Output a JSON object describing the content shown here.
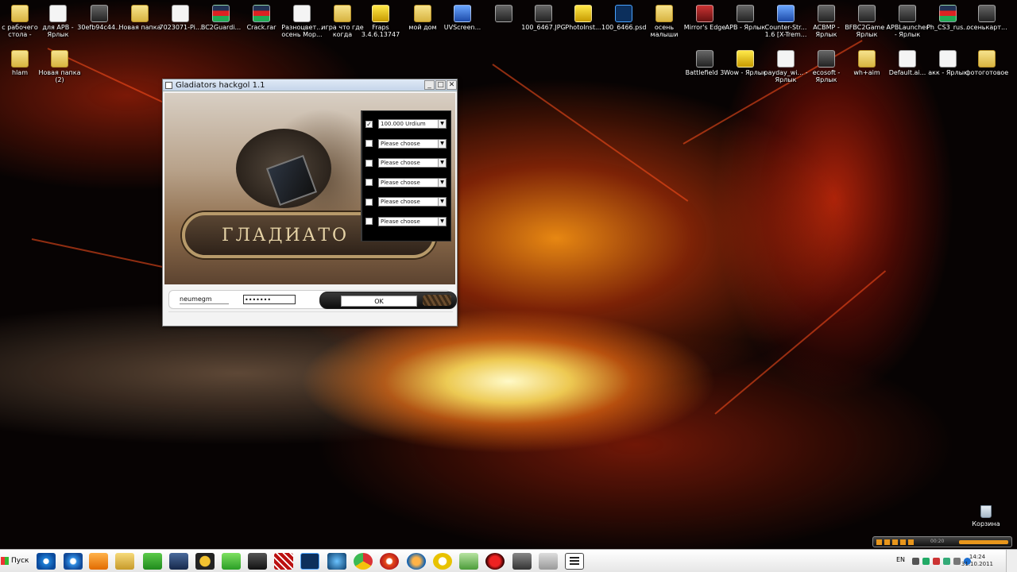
{
  "desktop": {
    "icons_row1": [
      {
        "label": "с рабочего стола - Ярлык",
        "icon": "folder-shortcut-icon",
        "kind": "folder"
      },
      {
        "label": "для APB - Ярлык",
        "icon": "file-shortcut-icon",
        "kind": "file"
      },
      {
        "label": "30efb94c44...",
        "icon": "image-file-icon",
        "kind": "dark"
      },
      {
        "label": "Новая папка",
        "icon": "folder-icon",
        "kind": "folder"
      },
      {
        "label": "7023071-Pi...",
        "icon": "file-icon",
        "kind": "file"
      },
      {
        "label": "BC2Guardi...",
        "icon": "rar-archive-icon",
        "kind": "flag"
      },
      {
        "label": "Crack.rar",
        "icon": "rar-archive-icon",
        "kind": "flag"
      },
      {
        "label": "Разноцвет... осень Мор...",
        "icon": "document-icon",
        "kind": "file"
      },
      {
        "label": "игра что где когда",
        "icon": "folder-icon",
        "kind": "folder"
      },
      {
        "label": "Fraps 3.4.6.13747",
        "icon": "fraps-icon",
        "kind": "yellow"
      },
      {
        "label": "мой дом",
        "icon": "folder-icon",
        "kind": "folder"
      },
      {
        "label": "UVScreen...",
        "icon": "uvscreen-icon",
        "kind": "blue"
      },
      {
        "label": "",
        "icon": "blank-icon",
        "kind": "dark"
      },
      {
        "label": "100_6467.JPG",
        "icon": "image-file-icon",
        "kind": "dark"
      },
      {
        "label": "PhotoInst...",
        "icon": "photo-icon",
        "kind": "yellow"
      },
      {
        "label": "100_6466.psd",
        "icon": "photoshop-file-icon",
        "kind": "ps"
      },
      {
        "label": "осень малыши",
        "icon": "folder-icon",
        "kind": "folder"
      },
      {
        "label": "Mirror's Edge",
        "icon": "mirrors-edge-icon",
        "kind": "app"
      },
      {
        "label": "APB - Ярлык",
        "icon": "apb-icon",
        "kind": "dark"
      },
      {
        "label": "Counter-Str... 1.6 [X-Trem...",
        "icon": "counter-strike-icon",
        "kind": "blue"
      },
      {
        "label": "ACBMP - Ярлык",
        "icon": "acbmp-icon",
        "kind": "dark"
      },
      {
        "label": "BFBC2Game - Ярлык",
        "icon": "bfbc2-icon",
        "kind": "dark"
      },
      {
        "label": "APBLauncher - Ярлык",
        "icon": "apb-launcher-icon",
        "kind": "dark"
      },
      {
        "label": "Ph_CS3_rus...",
        "icon": "rar-archive-icon",
        "kind": "flag"
      },
      {
        "label": "осенькарт...",
        "icon": "image-file-icon",
        "kind": "dark"
      }
    ],
    "icons_row2_left": [
      {
        "label": "hlam",
        "icon": "folder-icon",
        "kind": "folder"
      },
      {
        "label": "Новая папка (2)",
        "icon": "folder-icon",
        "kind": "folder"
      }
    ],
    "icons_row2_right": [
      {
        "label": "Battlefield 3",
        "icon": "battlefield-3-icon",
        "kind": "dark"
      },
      {
        "label": "Wow - Ярлык",
        "icon": "wow-icon",
        "kind": "yellow"
      },
      {
        "label": "payday_wi... - Ярлык",
        "icon": "payday-icon",
        "kind": "file"
      },
      {
        "label": "ecosoft - Ярлык",
        "icon": "ecosoft-icon",
        "kind": "dark"
      },
      {
        "label": "wh+aim",
        "icon": "folder-icon",
        "kind": "folder"
      },
      {
        "label": "Default.ai...",
        "icon": "ai-file-icon",
        "kind": "file"
      },
      {
        "label": "акк - Ярлык",
        "icon": "file-shortcut-icon",
        "kind": "file"
      },
      {
        "label": "фотоготовое",
        "icon": "folder-icon",
        "kind": "folder"
      }
    ],
    "recycle_bin": "Корзина"
  },
  "window": {
    "title": "Gladiators hackgol 1.1",
    "banner_text": "ГЛАДИАТО",
    "options": [
      {
        "checked": true,
        "value": "100.000 Urdium"
      },
      {
        "checked": false,
        "value": "Please choose"
      },
      {
        "checked": false,
        "value": "Please choose"
      },
      {
        "checked": false,
        "value": "Please choose"
      },
      {
        "checked": false,
        "value": "Please choose"
      },
      {
        "checked": false,
        "value": "Please choose"
      }
    ],
    "username": "neumegm",
    "password": "•••••••",
    "ok_label": "OK"
  },
  "taskbar": {
    "start_label": "Пуск",
    "language": "EN",
    "time": "14:24",
    "date": "31.10.2011",
    "media_time": "00:20"
  },
  "colors": {
    "accent": "#e8961c",
    "titlebar": "#c5d5ea"
  }
}
